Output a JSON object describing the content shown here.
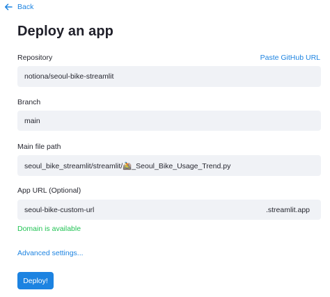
{
  "back": {
    "label": "Back"
  },
  "title": "Deploy an app",
  "repository": {
    "label": "Repository",
    "paste_link": "Paste GitHub URL",
    "value": "notiona/seoul-bike-streamlit"
  },
  "branch": {
    "label": "Branch",
    "value": "main"
  },
  "main_file": {
    "label": "Main file path",
    "value": "seoul_bike_streamlit/streamlit/🚵_Seoul_Bike_Usage_Trend.py"
  },
  "app_url": {
    "label": "App URL (Optional)",
    "value": "seoul-bike-custom-url",
    "suffix": ".streamlit.app",
    "status": "Domain is available"
  },
  "advanced_settings": "Advanced settings...",
  "deploy_button": "Deploy!",
  "colors": {
    "accent": "#1c83e1",
    "success": "#21c354",
    "field_bg": "#f0f2f6"
  }
}
